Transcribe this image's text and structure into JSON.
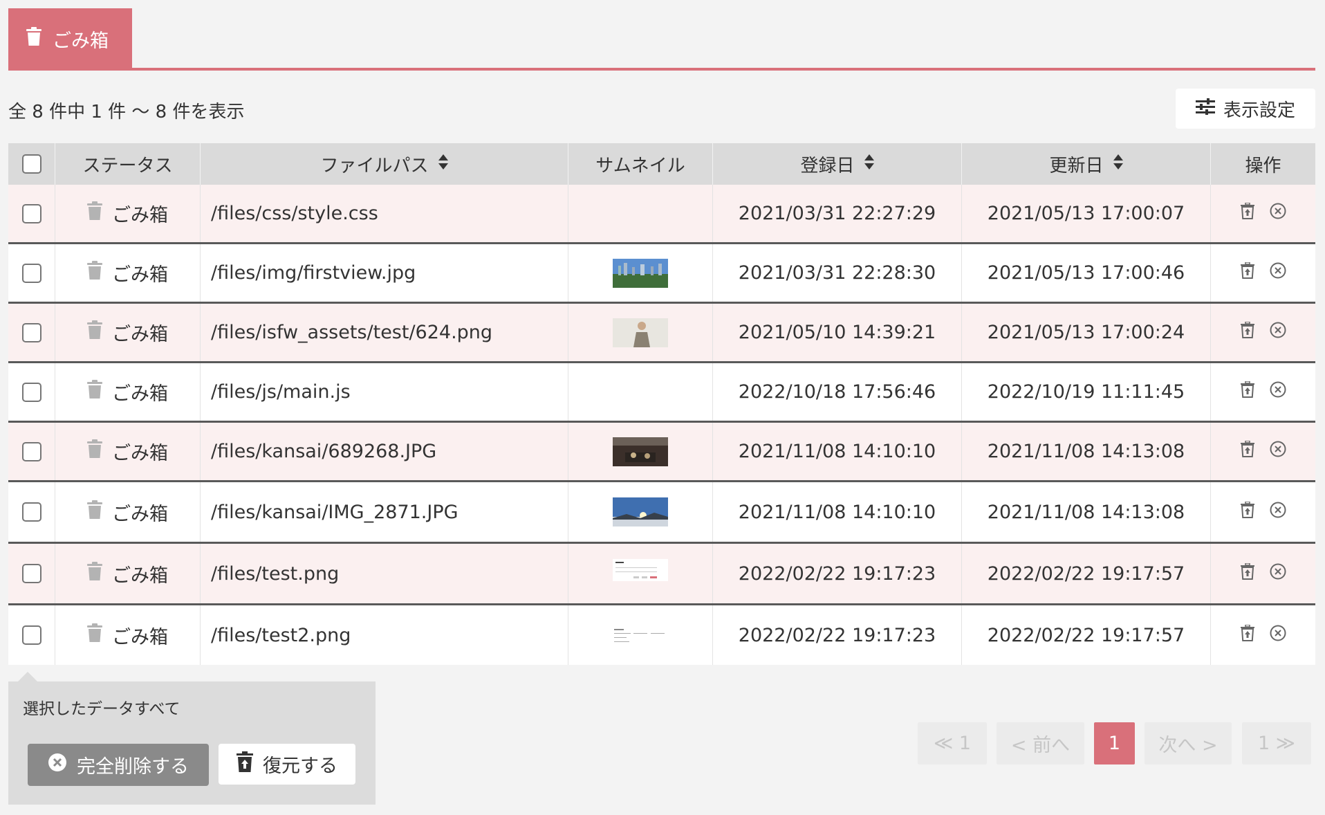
{
  "tab": {
    "label": "ごみ箱",
    "icon": "trash-icon"
  },
  "summary": {
    "text": "全 8 件中 1 件 〜 8 件を表示"
  },
  "settings": {
    "label": "表示設定",
    "icon": "sliders-icon"
  },
  "table": {
    "headers": {
      "status": "ステータス",
      "path": "ファイルパス",
      "thumbnail": "サムネイル",
      "registered": "登録日",
      "updated": "更新日",
      "operations": "操作"
    },
    "rows": [
      {
        "status": "ごみ箱",
        "path": "/files/css/style.css",
        "registered": "2021/03/31 22:27:29",
        "updated": "2021/05/13 17:00:07",
        "thumb": ""
      },
      {
        "status": "ごみ箱",
        "path": "/files/img/firstview.jpg",
        "registered": "2021/03/31 22:28:30",
        "updated": "2021/05/13 17:00:46",
        "thumb": "city"
      },
      {
        "status": "ごみ箱",
        "path": "/files/isfw_assets/test/624.png",
        "registered": "2021/05/10 14:39:21",
        "updated": "2021/05/13 17:00:24",
        "thumb": "person"
      },
      {
        "status": "ごみ箱",
        "path": "/files/js/main.js",
        "registered": "2022/10/18 17:56:46",
        "updated": "2022/10/19 11:11:45",
        "thumb": ""
      },
      {
        "status": "ごみ箱",
        "path": "/files/kansai/689268.JPG",
        "registered": "2021/11/08 14:10:10",
        "updated": "2021/11/08 14:13:08",
        "thumb": "dining"
      },
      {
        "status": "ごみ箱",
        "path": "/files/kansai/IMG_2871.JPG",
        "registered": "2021/11/08 14:10:10",
        "updated": "2021/11/08 14:13:08",
        "thumb": "sunrise"
      },
      {
        "status": "ごみ箱",
        "path": "/files/test.png",
        "registered": "2022/02/22 19:17:23",
        "updated": "2022/02/22 19:17:57",
        "thumb": "form"
      },
      {
        "status": "ごみ箱",
        "path": "/files/test2.png",
        "registered": "2022/02/22 19:17:23",
        "updated": "2022/02/22 19:17:57",
        "thumb": "doc"
      }
    ]
  },
  "bulk": {
    "title": "選択したデータすべて",
    "delete_label": "完全削除する",
    "restore_label": "復元する"
  },
  "pager": {
    "first": "≪ 1",
    "prev": "< 前へ",
    "current": "1",
    "next": "次へ >",
    "last": "1 ≫"
  },
  "colors": {
    "accent": "#d9707a",
    "alt_row": "#fbf0f0",
    "header_bg": "#dadada"
  }
}
